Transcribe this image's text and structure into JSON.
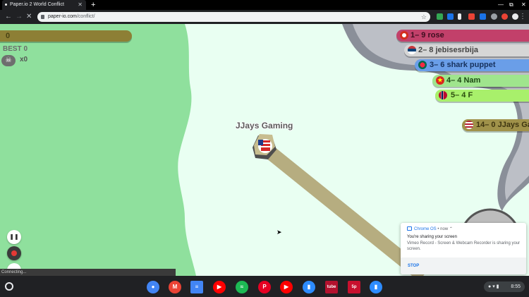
{
  "browser": {
    "tab_title": "Paper.io 2 World Conflict",
    "url_host": "paper-io.com",
    "url_path": "/conflict/"
  },
  "game": {
    "score": "0",
    "best": "BEST 0",
    "kills": "x0",
    "player_name": "JJays Gaming",
    "player_color": "#c7bd8f",
    "trail_color": "#b6ad80",
    "territory_green": "#8fe09d",
    "leaderboard": [
      {
        "text": "1– 9 rose",
        "color": "#c2406a",
        "text_color": "#3d0d1f"
      },
      {
        "text": "2– 8 jebisesrbija",
        "color": "#d6d6d6",
        "text_color": "#444444"
      },
      {
        "text": "3– 6 shark puppet",
        "color": "#6a9ee8",
        "text_color": "#17325e"
      },
      {
        "text": "4– 4 Nam",
        "color": "#9fe58d",
        "text_color": "#1e4a14"
      },
      {
        "text": "5– 4 F",
        "color": "#a8f06b",
        "text_color": "#2b4d0e"
      },
      {
        "text": "14– 0 JJays Ga",
        "color": "#a0924a",
        "text_color": "#3e3510"
      }
    ],
    "status": "Connecting..."
  },
  "notification": {
    "source": "Chrome OS",
    "time": "now",
    "title": "You're sharing your screen",
    "message": "Vimeo Record - Screen & Webcam Recorder is sharing your screen.",
    "action": "STOP"
  },
  "shelf": {
    "apps": [
      {
        "name": "chrome-icon",
        "color": "#4285f4",
        "glyph": "●"
      },
      {
        "name": "gmail-icon",
        "color": "#ea4335",
        "glyph": "M"
      },
      {
        "name": "docs-icon",
        "color": "#4285f4",
        "glyph": "≡"
      },
      {
        "name": "youtube-icon",
        "color": "#ff0000",
        "glyph": "▶"
      },
      {
        "name": "spotify-icon",
        "color": "#1db954",
        "glyph": "≈"
      },
      {
        "name": "pinterest-icon",
        "color": "#e60023",
        "glyph": "P"
      },
      {
        "name": "youtube-music-icon",
        "color": "#ff0000",
        "glyph": "▶"
      },
      {
        "name": "zoom-icon",
        "color": "#2d8cff",
        "glyph": "▮"
      },
      {
        "name": "tube-icon",
        "color": "#b3122e",
        "glyph": "tube"
      },
      {
        "name": "5p-icon",
        "color": "#c8102e",
        "glyph": "5p"
      },
      {
        "name": "zoom-meetings-icon",
        "color": "#2d8cff",
        "glyph": "▮"
      }
    ],
    "time": "8:55"
  }
}
